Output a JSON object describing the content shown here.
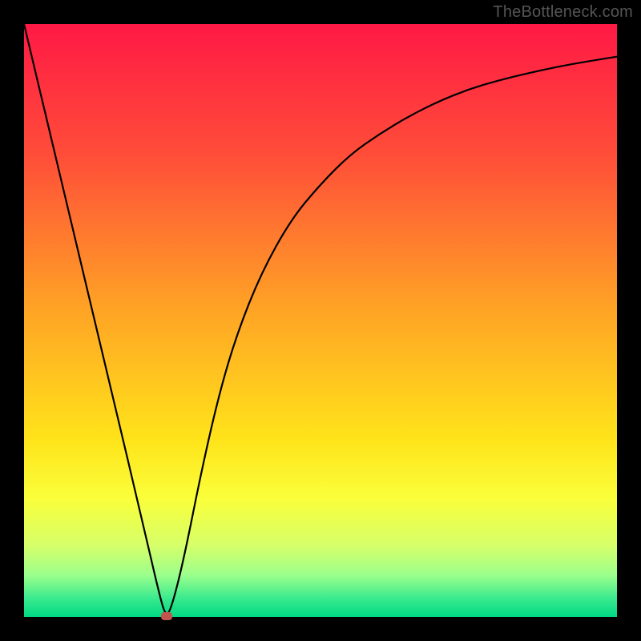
{
  "watermark": "TheBottleneck.com",
  "colors": {
    "frame": "#000000",
    "curve": "#000000",
    "marker": "#c1554d",
    "gradient_stops": [
      {
        "pct": 0,
        "color": "#ff1945"
      },
      {
        "pct": 22,
        "color": "#ff4d39"
      },
      {
        "pct": 48,
        "color": "#ffa325"
      },
      {
        "pct": 70,
        "color": "#ffe31a"
      },
      {
        "pct": 80,
        "color": "#faff3a"
      },
      {
        "pct": 88,
        "color": "#d6ff6a"
      },
      {
        "pct": 93,
        "color": "#9aff8c"
      },
      {
        "pct": 97,
        "color": "#37e98e"
      },
      {
        "pct": 100,
        "color": "#00d983"
      }
    ]
  },
  "chart_data": {
    "type": "line",
    "title": "",
    "xlabel": "",
    "ylabel": "",
    "xlim": [
      0,
      100
    ],
    "ylim": [
      0,
      100
    ],
    "series": [
      {
        "name": "bottleneck-curve",
        "x": [
          0,
          5,
          10,
          15,
          20,
          23,
          24,
          25,
          27,
          30,
          33,
          36,
          40,
          45,
          50,
          55,
          60,
          65,
          70,
          75,
          80,
          85,
          90,
          95,
          100
        ],
        "values": [
          100,
          79,
          58,
          37,
          16,
          3,
          0,
          2,
          10,
          25,
          38,
          48,
          58,
          67,
          73,
          78,
          81.5,
          84.5,
          87,
          89,
          90.5,
          91.7,
          92.8,
          93.7,
          94.5
        ]
      }
    ],
    "marker_point": {
      "x": 24,
      "y": 0
    },
    "notes": "V-shaped curve on a red→green vertical gradient. Minimum (optimal point) sits near x≈24%. Left branch is linear from (0,100) to the minimum; right branch rises with diminishing slope toward ~94.5 at x=100. Values are read off the plot area where y=0 is the bottom green edge and y=100 is the top red edge."
  }
}
